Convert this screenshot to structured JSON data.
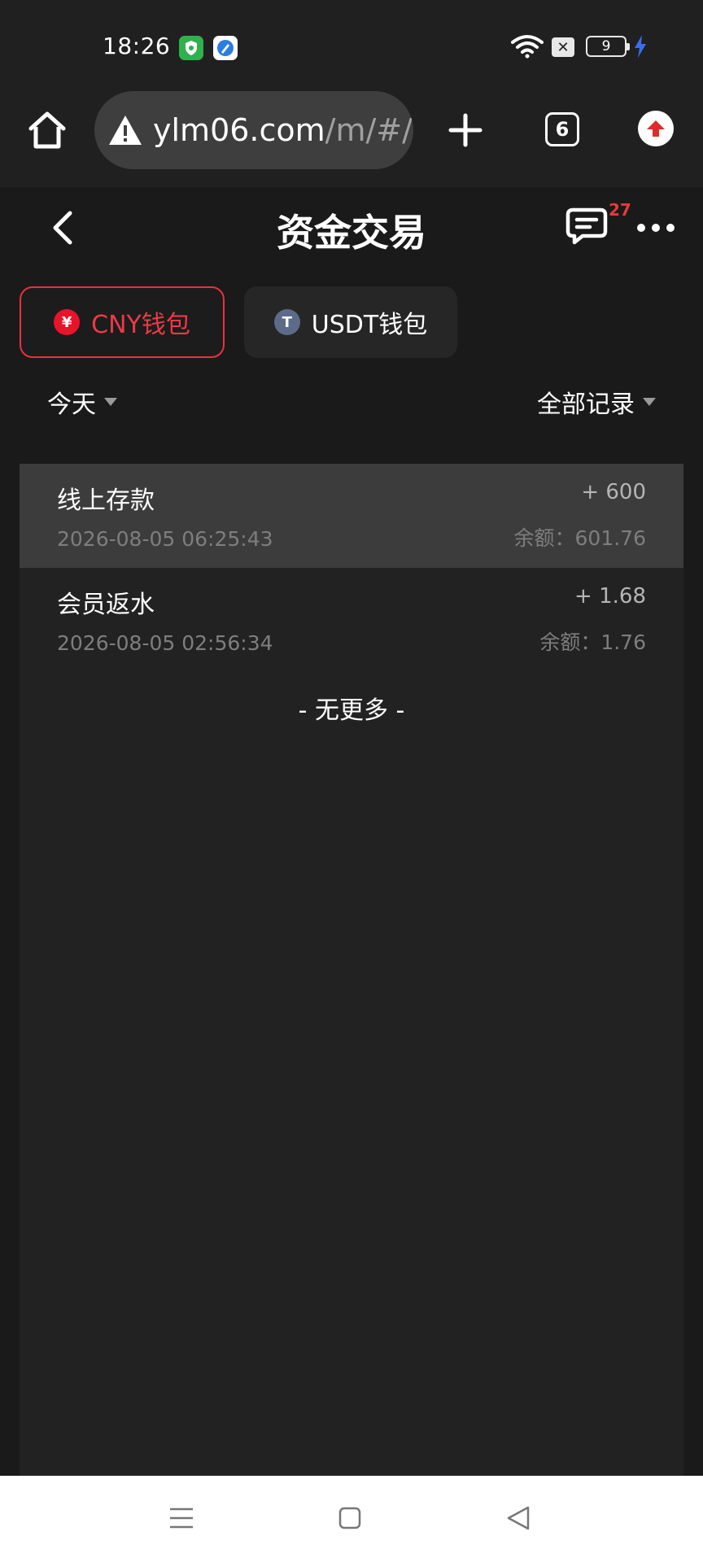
{
  "status_bar": {
    "time": "18:26",
    "battery": "9",
    "icons": [
      "shield-app-icon",
      "browser-app-icon",
      "wifi-icon",
      "x-notification-icon",
      "battery-icon",
      "charging-bolt-icon"
    ]
  },
  "browser": {
    "url_domain": "ylm06.com",
    "url_path": "/m/#/r",
    "tab_count": "6"
  },
  "header": {
    "title": "资金交易",
    "message_count": "27"
  },
  "wallets": {
    "cny_label": "CNY钱包",
    "cny_symbol": "¥",
    "usdt_label": "USDT钱包",
    "usdt_symbol": "T",
    "active": "cny"
  },
  "filters": {
    "date": "今天",
    "record_type": "全部记录"
  },
  "transactions": [
    {
      "title": "线上存款",
      "time": "2026-08-05 06:25:43",
      "amount": "+ 600",
      "balance": "余额：601.76"
    },
    {
      "title": "会员返水",
      "time": "2026-08-05 02:56:34",
      "amount": "+ 1.68",
      "balance": "余额：1.76"
    }
  ],
  "list_footer": "- 无更多 -",
  "colors": {
    "accent_red": "#e8323e",
    "background": "#1a1a1a",
    "panel": "#222222",
    "highlight_row": "#3c3c3c"
  }
}
